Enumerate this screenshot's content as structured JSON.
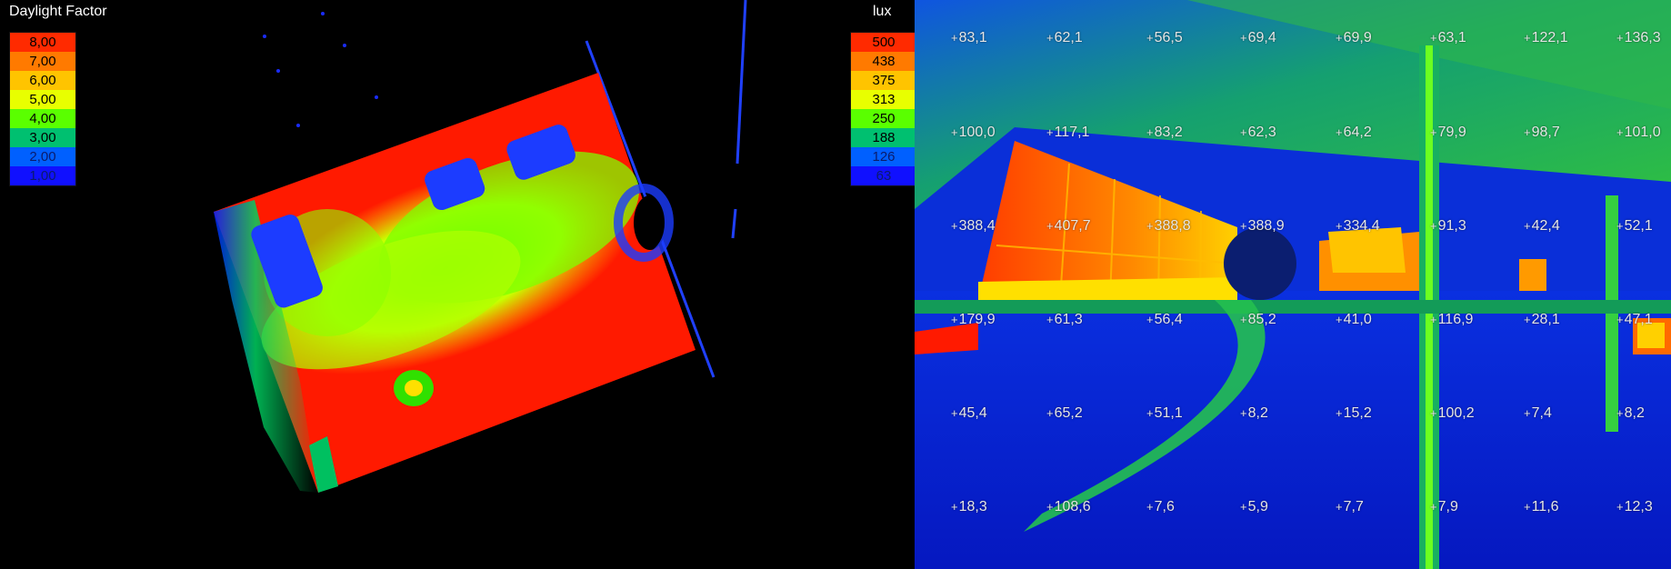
{
  "left": {
    "legend_title": "Daylight Factor",
    "legend": [
      "8,00",
      "7,00",
      "6,00",
      "5,00",
      "4,00",
      "3,00",
      "2,00",
      "1,00"
    ]
  },
  "right": {
    "legend_title": "lux",
    "legend": [
      "500",
      "438",
      "375",
      "313",
      "250",
      "188",
      "126",
      "63"
    ],
    "grid_rows": [
      [
        "83,1",
        "62,1",
        "56,5",
        "69,4",
        "69,9",
        "63,1",
        "122,1",
        "136,3"
      ],
      [
        "100,0",
        "117,1",
        "83,2",
        "62,3",
        "64,2",
        "79,9",
        "98,7",
        "101,0"
      ],
      [
        "388,4",
        "407,7",
        "388,8",
        "388,9",
        "334,4",
        "91,3",
        "42,4",
        "52,1"
      ],
      [
        "179,9",
        "61,3",
        "56,4",
        "85,2",
        "41,0",
        "116,9",
        "28,1",
        "47,1"
      ],
      [
        "45,4",
        "65,2",
        "51,1",
        "8,2",
        "15,2",
        "100,2",
        "7,4",
        "8,2"
      ],
      [
        "18,3",
        "108,6",
        "7,6",
        "5,9",
        "7,7",
        "7,9",
        "11,6",
        "12,3"
      ]
    ]
  },
  "legend_colors": [
    "#ff2a00",
    "#ff7a00",
    "#ffc400",
    "#e8ff00",
    "#5aff00",
    "#00c070",
    "#0060ff",
    "#1010ff"
  ]
}
